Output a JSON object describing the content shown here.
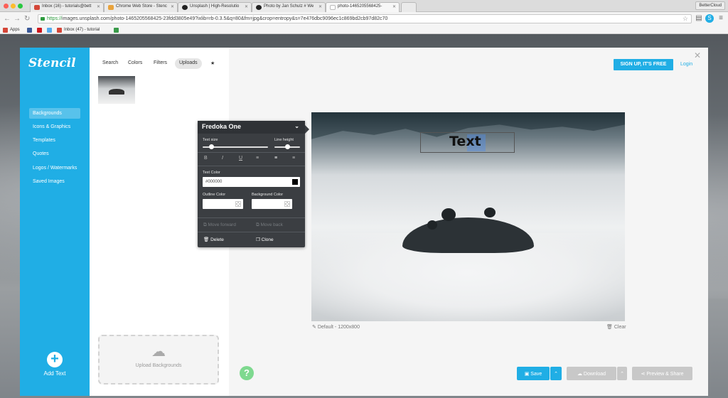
{
  "browser": {
    "tabs": [
      {
        "title": "Inbox (16) - tutorials@bett",
        "active": false,
        "favicon_color": "#d44638"
      },
      {
        "title": "Chrome Web Store - Stenc",
        "active": false,
        "favicon_color": "#e8a33c"
      },
      {
        "title": "Unsplash | High-Resolutio",
        "active": false,
        "favicon_color": "#222222"
      },
      {
        "title": "Photo by Jan Schulz # We",
        "active": false,
        "favicon_color": "#222222"
      },
      {
        "title": "photo-1465205568425-",
        "active": true,
        "favicon_color": "#bbbbbb"
      }
    ],
    "profile": "BetterCloud",
    "address": {
      "scheme": "https://",
      "rest": "images.unsplash.com/photo-1465205568425-23fdd3805e49?ixlib=rb-0.3.5&q=80&fm=jpg&crop=entropy&s=7e476dbc9096ec1c869bd2cb97d82c70"
    },
    "bookmarks": [
      {
        "label": "Apps",
        "color": "#d44638"
      },
      {
        "label": "",
        "color": "#3b5998"
      },
      {
        "label": "",
        "color": "#cc181e"
      },
      {
        "label": "",
        "color": "#55acee"
      },
      {
        "label": "Inbox (47) - tutorial",
        "color": "#d44638"
      },
      {
        "label": "",
        "color": "#3a9b4a"
      }
    ]
  },
  "app": {
    "logo": "Stencil",
    "sidebar": {
      "items": [
        "Backgrounds",
        "Icons & Graphics",
        "Templates",
        "Quotes",
        "Logos / Watermarks",
        "Saved Images"
      ],
      "active_index": 0,
      "add_text": "Add Text"
    },
    "panel": {
      "tabs": [
        "Search",
        "Colors",
        "Filters",
        "Uploads",
        "★"
      ],
      "active_tab": 3,
      "upload_label": "Upload Backgrounds"
    },
    "header": {
      "signup": "SIGN UP, IT'S FREE",
      "login": "Login",
      "close": "✕"
    },
    "canvas": {
      "text": "Text",
      "size_label": "Default - 1200x800",
      "clear": "Clear"
    },
    "text_props": {
      "font": "Fredoka One",
      "text_size_label": "Text size",
      "text_size_value": 0.14,
      "line_height_label": "Line height",
      "line_height_value": 0.5,
      "text_color_label": "Text Color",
      "text_color_value": "#000000",
      "outline_color_label": "Outline Color",
      "background_color_label": "Background Color",
      "move_forward": "Move forward",
      "move_back": "Move back",
      "delete": "Delete",
      "clone": "Clone"
    },
    "footer": {
      "save": "Save",
      "download": "Download",
      "preview": "Preview & Share",
      "help": "?"
    },
    "colors": {
      "accent": "#20aee5",
      "help_green": "#7ed98f",
      "panel_dark": "#3b3e42"
    }
  }
}
